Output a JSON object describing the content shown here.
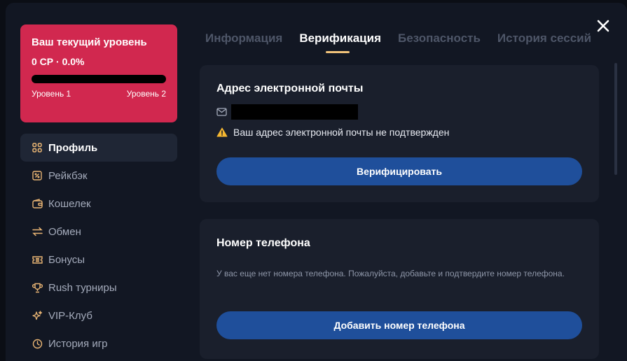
{
  "level": {
    "title": "Ваш текущий уровень",
    "points": "0 СР · 0.0%",
    "progress_percent": 0.0,
    "current_level": "Уровень 1",
    "next_level": "Уровень 2",
    "card_color": "#d1284f"
  },
  "menu": {
    "items": [
      {
        "label": "Профиль",
        "icon": "grid-icon"
      },
      {
        "label": "Рейкбэк",
        "icon": "percent-icon"
      },
      {
        "label": "Кошелек",
        "icon": "wallet-icon"
      },
      {
        "label": "Обмен",
        "icon": "exchange-icon"
      },
      {
        "label": "Бонусы",
        "icon": "ticket-icon"
      },
      {
        "label": "Rush турниры",
        "icon": "trophy-icon"
      },
      {
        "label": "VIP-Клуб",
        "icon": "sparkle-icon"
      },
      {
        "label": "История игр",
        "icon": "clock-icon"
      }
    ],
    "active_index": 0
  },
  "tabs": {
    "items": [
      "Информация",
      "Верификация",
      "Безопасность",
      "История сессий"
    ],
    "active_index": 1
  },
  "email_section": {
    "title": "Адрес электронной почты",
    "warning": "Ваш адрес электронной почты не подтвержден",
    "verify_button": "Верифицировать"
  },
  "phone_section": {
    "title": "Номер телефона",
    "description": "У вас еще нет номера телефона. Пожалуйста, добавьте и подтвердите номер телефона.",
    "add_button": "Добавить номер телефона"
  },
  "colors": {
    "accent": "#f0c27a",
    "primary_button": "#1f4f9b",
    "warning": "#f5b731"
  }
}
